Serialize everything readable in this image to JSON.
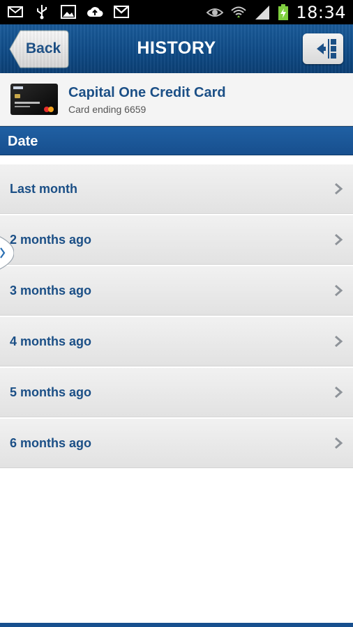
{
  "status_bar": {
    "time": "18:34",
    "left_icons": [
      "mail-icon",
      "usb-icon",
      "image-icon",
      "cloud-upload-icon",
      "gmail-icon"
    ],
    "right_icons": [
      "eye-icon",
      "wifi-icon",
      "signal-icon",
      "battery-charging-icon"
    ]
  },
  "header": {
    "back_label": "Back",
    "title": "HISTORY",
    "menu_icon": "drawer-menu-icon",
    "brand_color": "#174f8e"
  },
  "account": {
    "name": "Capital One Credit Card",
    "subtitle": "Card ending 6659"
  },
  "section": {
    "label": "Date"
  },
  "history_items": [
    {
      "label": "Last month"
    },
    {
      "label": "2 months ago"
    },
    {
      "label": "3 months ago"
    },
    {
      "label": "4 months ago"
    },
    {
      "label": "5 months ago"
    },
    {
      "label": "6 months ago"
    }
  ]
}
